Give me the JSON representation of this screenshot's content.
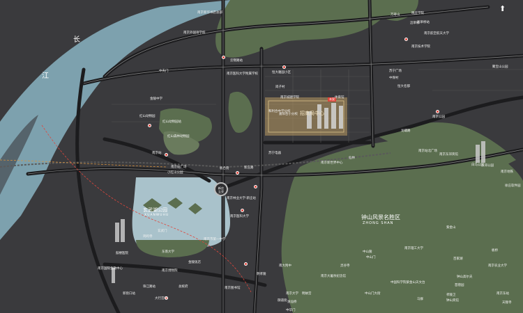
{
  "colors": {
    "background": "#3a3a3d",
    "river": "#7da1ae",
    "green": "#5b6e4f",
    "green_light": "#6a7b5d",
    "road": "#1c1c1e",
    "road_edge": "#8a8a8a",
    "accent_red": "#e0463c",
    "lake": "#a9c2cb",
    "site_gold": "#b99b63"
  },
  "river_labels": {
    "char1": "长",
    "char2": "江"
  },
  "compass": {
    "icon": "compass-north-icon",
    "glyph": "⬆"
  },
  "parks": {
    "xuanwu": {
      "cn": "玄武湖公园",
      "en": "XUANWUHU"
    },
    "zhongshan": {
      "cn": "钟山风景名胜区",
      "en": "ZHONG SHAN"
    }
  },
  "junction": {
    "line1": "新庄",
    "line2": "立交"
  },
  "project": {
    "name": "招商局中心",
    "tag": "本案"
  },
  "labels": [
    "南京新华书店总部",
    "南京外国语学校",
    "金陵中学",
    "红山动物园站",
    "红山森林动物园",
    "南京站",
    "南京站广场",
    "小红山公园",
    "玄武门",
    "南京林业大学·新庄站",
    "南京医科大学",
    "鸡鸣寺",
    "南京市第一中学",
    "中山门",
    "中山陵",
    "明孝陵",
    "灵谷寺",
    "南京理工大学",
    "大行宫站",
    "新街口站",
    "珠江路站",
    "鼓楼医院",
    "南京国际金融中心",
    "东南大学",
    "南京博物院",
    "总统府",
    "南京图书馆",
    "和利合中学分校",
    "嘉阳合小分校",
    "恒大雅园小区",
    "南京城建学院",
    "苏宁广场",
    "体育馆",
    "中华门",
    "南京航空航天大学",
    "万寿山",
    "聚宝山公园",
    "红山动物园",
    "晓庄学院",
    "迈皋桥站",
    "南京技术学院",
    "中央门",
    "云锦路站",
    "南京医科大学附属学校",
    "岗子村",
    "板仓街",
    "新庄路",
    "苏宁电器",
    "南京新世界中心",
    "迈皋桥",
    "中保村",
    "恒大名都",
    "龙蟠路",
    "南京公园",
    "金陵饭店",
    "南大附中",
    "南京大学",
    "南京东郊宾馆",
    "白马公园",
    "南京站北广场",
    "紫金山",
    "钟山高尔夫",
    "钟山宾馆",
    "中国科学院紫金山天文台",
    "南京大屠杀纪念馆",
    "东郊公园",
    "御道街",
    "逸仙桥",
    "明故宫",
    "中山门大街",
    "苜蓿园",
    "孝陵卫",
    "南京农业大学",
    "南京地铁",
    "徐庄软件园",
    "仙林",
    "马群",
    "南京东站",
    "天隆寺",
    "板桥",
    "百家湖"
  ]
}
